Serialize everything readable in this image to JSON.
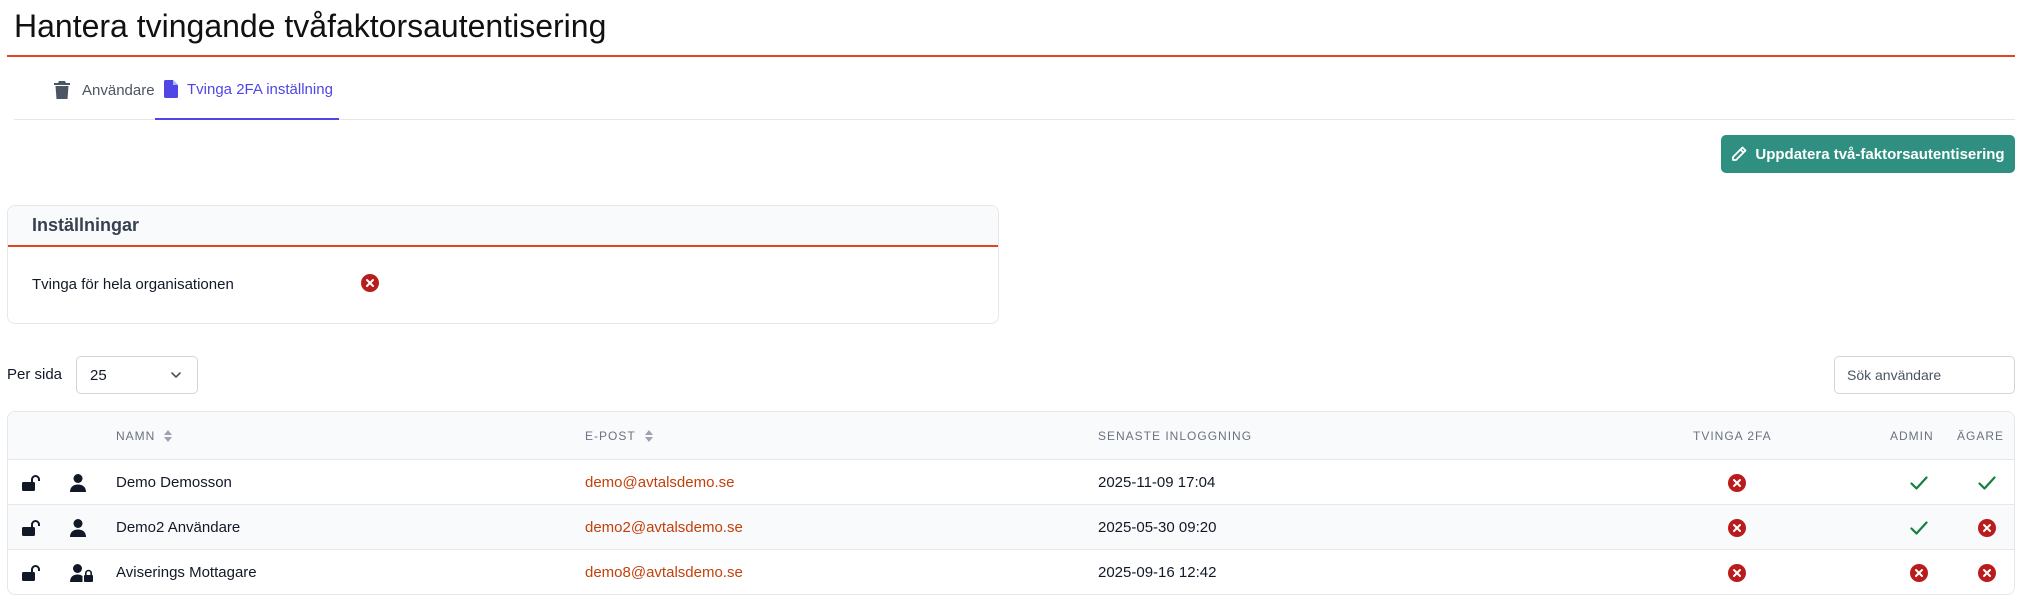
{
  "page": {
    "title": "Hantera tvingande tvåfaktorsautentisering"
  },
  "tabs": [
    {
      "label": "Användare",
      "icon": "trash-icon",
      "active": false
    },
    {
      "label": "Tvinga 2FA inställning",
      "icon": "document-icon",
      "active": true
    }
  ],
  "actions": {
    "update_label": "Uppdatera två-faktorsautentisering",
    "icon": "pencil-icon"
  },
  "settings": {
    "title": "Inställningar",
    "rows": [
      {
        "label": "Tvinga för hela organisationen",
        "status": "off"
      }
    ]
  },
  "pagination": {
    "per_page_label": "Per sida",
    "per_page_value": "25"
  },
  "search": {
    "placeholder": "Sök användare",
    "value": ""
  },
  "table": {
    "headers": {
      "name": "Namn",
      "email": "E-post",
      "last_login": "Senaste inloggning",
      "force_2fa": "Tvinga 2FA",
      "admin": "Admin",
      "owner": "Ägare"
    },
    "rows": [
      {
        "lock": "unlocked",
        "user_icon": "user-icon",
        "name": "Demo Demosson",
        "email": "demo@avtalsdemo.se",
        "last_login": "2025-11-09 17:04",
        "force_2fa": false,
        "admin": true,
        "owner": true
      },
      {
        "lock": "unlocked",
        "user_icon": "user-icon",
        "name": "Demo2 Användare",
        "email": "demo2@avtalsdemo.se",
        "last_login": "2025-05-30 09:20",
        "force_2fa": false,
        "admin": true,
        "owner": false
      },
      {
        "lock": "unlocked",
        "user_icon": "user-lock-icon",
        "name": "Aviserings Mottagare",
        "email": "demo8@avtalsdemo.se",
        "last_login": "2025-09-16 12:42",
        "force_2fa": false,
        "admin": false,
        "owner": false
      }
    ]
  },
  "colors": {
    "accent": "#e0451f",
    "primary": "#4f46e5",
    "button": "#2f8f80",
    "link": "#c2410c",
    "error": "#b91c1c",
    "success": "#15803d"
  }
}
